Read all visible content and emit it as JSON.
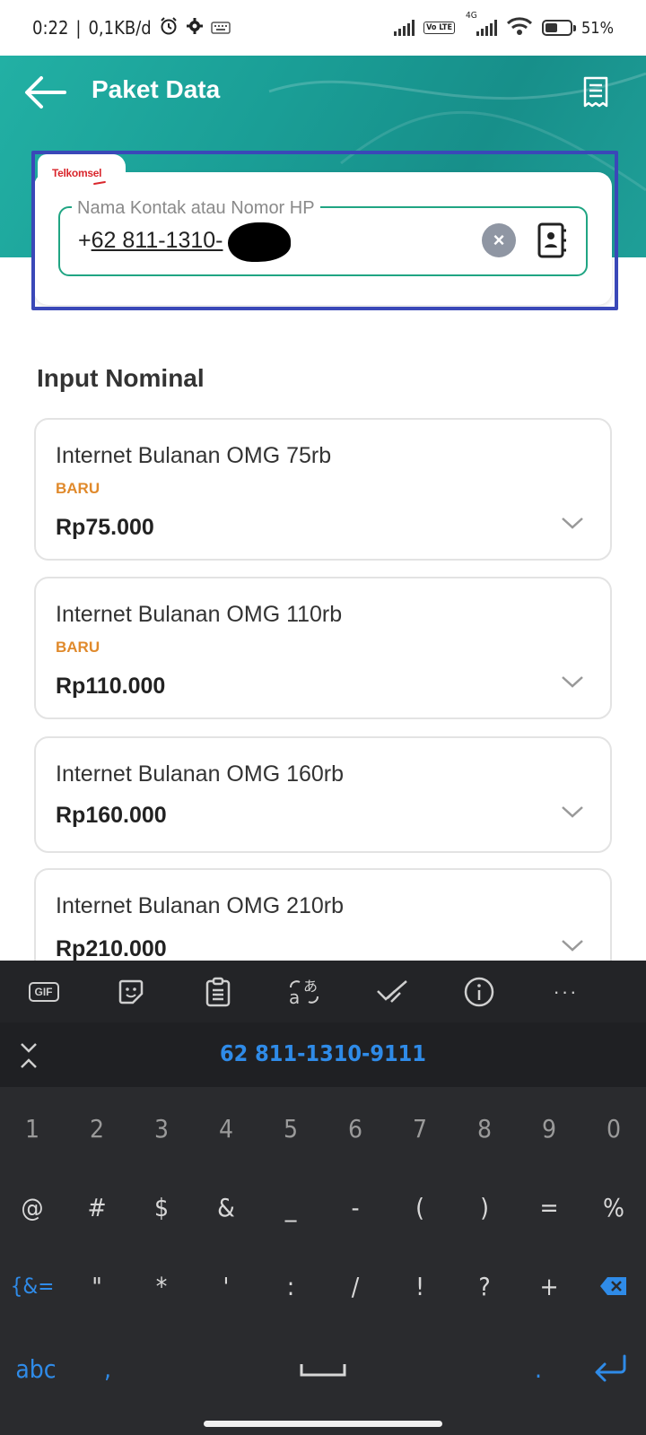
{
  "status_bar": {
    "time": "0:22",
    "data_speed": "0,1KB/d",
    "network_type": "4G",
    "volte": "Vo LTE",
    "battery": "51%",
    "battery_level": 0.51
  },
  "header": {
    "title": "Paket Data"
  },
  "phone_input": {
    "operator": "Telkomsel",
    "label": "Nama Kontak atau Nomor HP",
    "prefix": "+",
    "value": "62 811-1310-"
  },
  "section": {
    "title": "Input Nominal"
  },
  "products": [
    {
      "name": "Internet Bulanan OMG 75rb",
      "badge": "BARU",
      "price": "Rp75.000"
    },
    {
      "name": "Internet Bulanan OMG 110rb",
      "badge": "BARU",
      "price": "Rp110.000"
    },
    {
      "name": "Internet Bulanan OMG 160rb",
      "badge": "",
      "price": "Rp160.000"
    },
    {
      "name": "Internet Bulanan OMG 210rb",
      "badge": "",
      "price": "Rp210.000"
    }
  ],
  "keyboard": {
    "toolbar": [
      "GIF",
      "sticker",
      "clipboard",
      "translate",
      "spell-check",
      "info",
      "more"
    ],
    "gif_label": "GIF",
    "more_label": "···",
    "suggestion": "62 811-1310-9111",
    "row_numbers": [
      "1",
      "2",
      "3",
      "4",
      "5",
      "6",
      "7",
      "8",
      "9",
      "0"
    ],
    "row_symbols1": [
      "@",
      "#",
      "$",
      "&",
      "_",
      "-",
      "(",
      ")",
      "=",
      "%"
    ],
    "row_symbols2": [
      "{&=",
      "\"",
      "*",
      "'",
      ":",
      "/",
      "!",
      "?",
      "+"
    ],
    "abc_label": "abc",
    "comma": ",",
    "period": "."
  },
  "colors": {
    "header": "#1a9e96",
    "accent_green": "#20a583",
    "badge": "#e08a2c",
    "highlight": "#3a48b8",
    "keyboard_blue": "#2f8be8"
  }
}
